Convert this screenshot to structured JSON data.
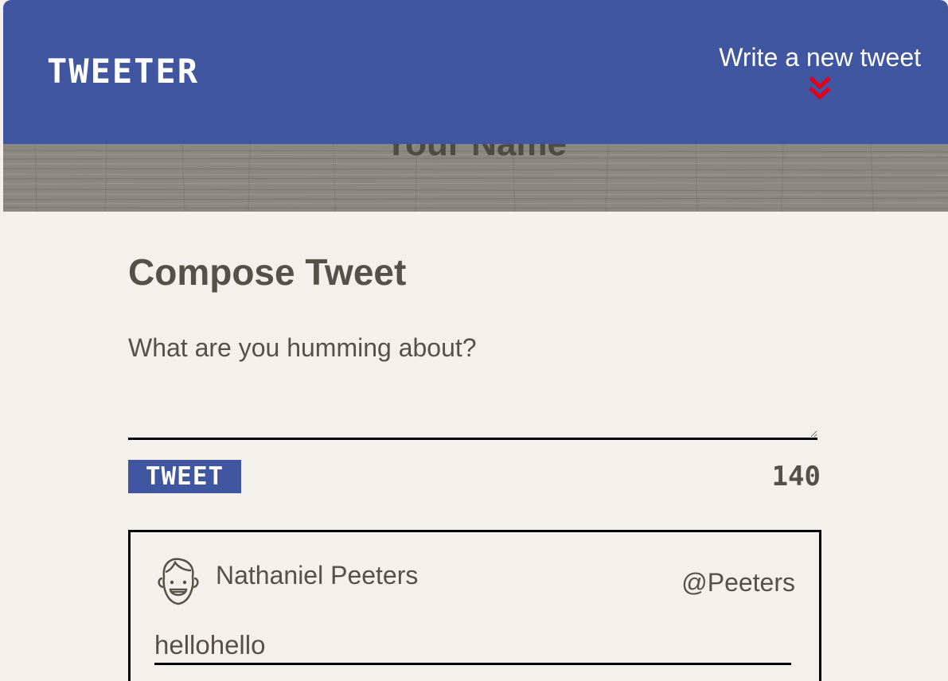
{
  "nav": {
    "brand": "tweeter",
    "write_link_label": "Write a new tweet",
    "write_link_icon": "double-chevron-down-icon",
    "accent_color": "#4056a1",
    "icon_color": "#e0001b"
  },
  "header": {
    "user_name": "Your Name"
  },
  "compose": {
    "title": "Compose Tweet",
    "placeholder": "What are you humming about?",
    "value": "",
    "tweet_button_label": "tweet",
    "char_counter": "140"
  },
  "tweets": [
    {
      "author_name": "Nathaniel Peeters",
      "handle": "@Peeters",
      "avatar_icon": "smiling-boy-avatar-icon",
      "content": "hellohello"
    }
  ]
}
